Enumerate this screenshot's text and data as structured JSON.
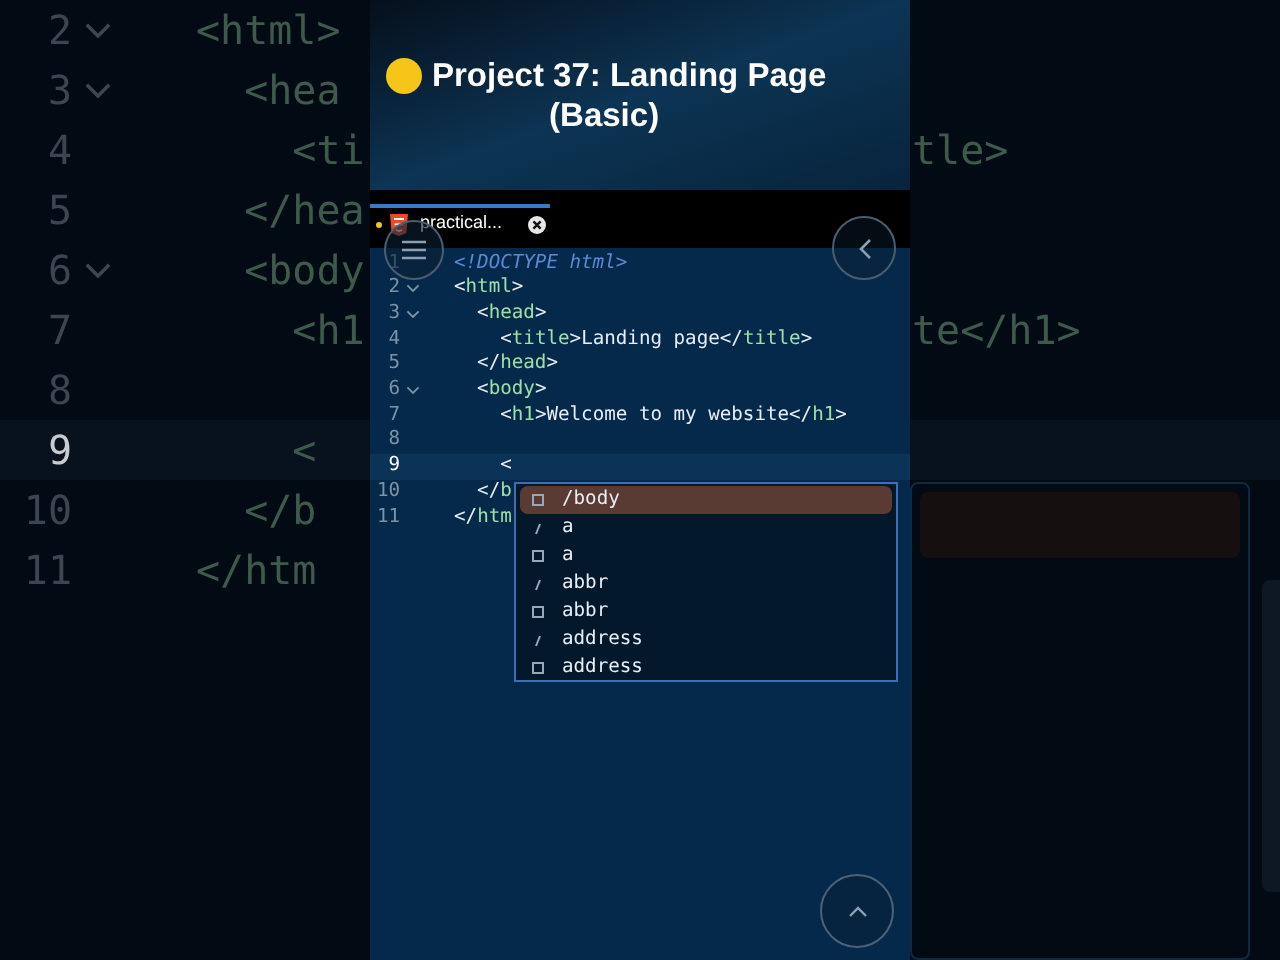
{
  "background_code": [
    {
      "number": "2",
      "foldable": true,
      "current": false,
      "left": "<html>"
    },
    {
      "number": "3",
      "foldable": true,
      "current": false,
      "left": "  <hea"
    },
    {
      "number": "4",
      "foldable": false,
      "current": false,
      "left": "    <ti",
      "right": "tle>"
    },
    {
      "number": "5",
      "foldable": false,
      "current": false,
      "left": "  </hea"
    },
    {
      "number": "6",
      "foldable": true,
      "current": false,
      "left": "  <body"
    },
    {
      "number": "7",
      "foldable": false,
      "current": false,
      "left": "    <h1",
      "right": "te</h1>"
    },
    {
      "number": "8",
      "foldable": false,
      "current": false
    },
    {
      "number": "9",
      "foldable": false,
      "current": true,
      "left": "    <"
    },
    {
      "number": "10",
      "foldable": false,
      "current": false,
      "left": "  </b"
    },
    {
      "number": "11",
      "foldable": false,
      "current": false,
      "left": "</htm"
    }
  ],
  "title": {
    "line1": "Project 37: Landing Page",
    "line2": "(Basic)"
  },
  "tab": {
    "label": "practical...",
    "modified": true
  },
  "lines": [
    {
      "number": "1",
      "foldable": false,
      "current": false,
      "tokens": [
        {
          "kind": "doctype",
          "text": "<!DOCTYPE html>"
        }
      ]
    },
    {
      "number": "2",
      "foldable": true,
      "current": false,
      "tokens": [
        {
          "kind": "punct",
          "text": "<"
        },
        {
          "kind": "tag",
          "text": "html"
        },
        {
          "kind": "punct",
          "text": ">"
        }
      ]
    },
    {
      "number": "3",
      "foldable": true,
      "current": false,
      "tokens": [
        {
          "kind": "punct",
          "text": "  <"
        },
        {
          "kind": "tag",
          "text": "head"
        },
        {
          "kind": "punct",
          "text": ">"
        }
      ]
    },
    {
      "number": "4",
      "foldable": false,
      "current": false,
      "tokens": [
        {
          "kind": "punct",
          "text": "    <"
        },
        {
          "kind": "tag",
          "text": "title"
        },
        {
          "kind": "punct",
          "text": ">"
        },
        {
          "kind": "text",
          "text": "Landing page"
        },
        {
          "kind": "punct",
          "text": "</"
        },
        {
          "kind": "tag",
          "text": "title"
        },
        {
          "kind": "punct",
          "text": ">"
        }
      ]
    },
    {
      "number": "5",
      "foldable": false,
      "current": false,
      "tokens": [
        {
          "kind": "punct",
          "text": "  </"
        },
        {
          "kind": "tag",
          "text": "head"
        },
        {
          "kind": "punct",
          "text": ">"
        }
      ]
    },
    {
      "number": "6",
      "foldable": true,
      "current": false,
      "tokens": [
        {
          "kind": "punct",
          "text": "  <"
        },
        {
          "kind": "tag",
          "text": "body"
        },
        {
          "kind": "punct",
          "text": ">"
        }
      ]
    },
    {
      "number": "7",
      "foldable": false,
      "current": false,
      "tokens": [
        {
          "kind": "punct",
          "text": "    <"
        },
        {
          "kind": "tag",
          "text": "h1"
        },
        {
          "kind": "punct",
          "text": ">"
        },
        {
          "kind": "text",
          "text": "Welcome to my website"
        },
        {
          "kind": "punct",
          "text": "</"
        },
        {
          "kind": "tag",
          "text": "h1"
        },
        {
          "kind": "punct",
          "text": ">"
        }
      ]
    },
    {
      "number": "8",
      "foldable": false,
      "current": false
    },
    {
      "number": "9",
      "foldable": false,
      "current": true,
      "tokens": [
        {
          "kind": "punct",
          "text": "    <"
        }
      ]
    },
    {
      "number": "10",
      "foldable": false,
      "current": false,
      "tokens": [
        {
          "kind": "punct",
          "text": "  </"
        },
        {
          "kind": "tag",
          "text": "b"
        }
      ]
    },
    {
      "number": "11",
      "foldable": false,
      "current": false,
      "tokens": [
        {
          "kind": "punct",
          "text": "</"
        },
        {
          "kind": "tag",
          "text": "htm"
        }
      ]
    }
  ],
  "suggestions": [
    {
      "kind": "tag",
      "label": "/body",
      "selected": true
    },
    {
      "kind": "snippet",
      "label": "a",
      "selected": false
    },
    {
      "kind": "tag",
      "label": "a",
      "selected": false
    },
    {
      "kind": "snippet",
      "label": "abbr",
      "selected": false
    },
    {
      "kind": "tag",
      "label": "abbr",
      "selected": false
    },
    {
      "kind": "snippet",
      "label": "address",
      "selected": false
    },
    {
      "kind": "tag",
      "label": "address",
      "selected": false
    }
  ]
}
